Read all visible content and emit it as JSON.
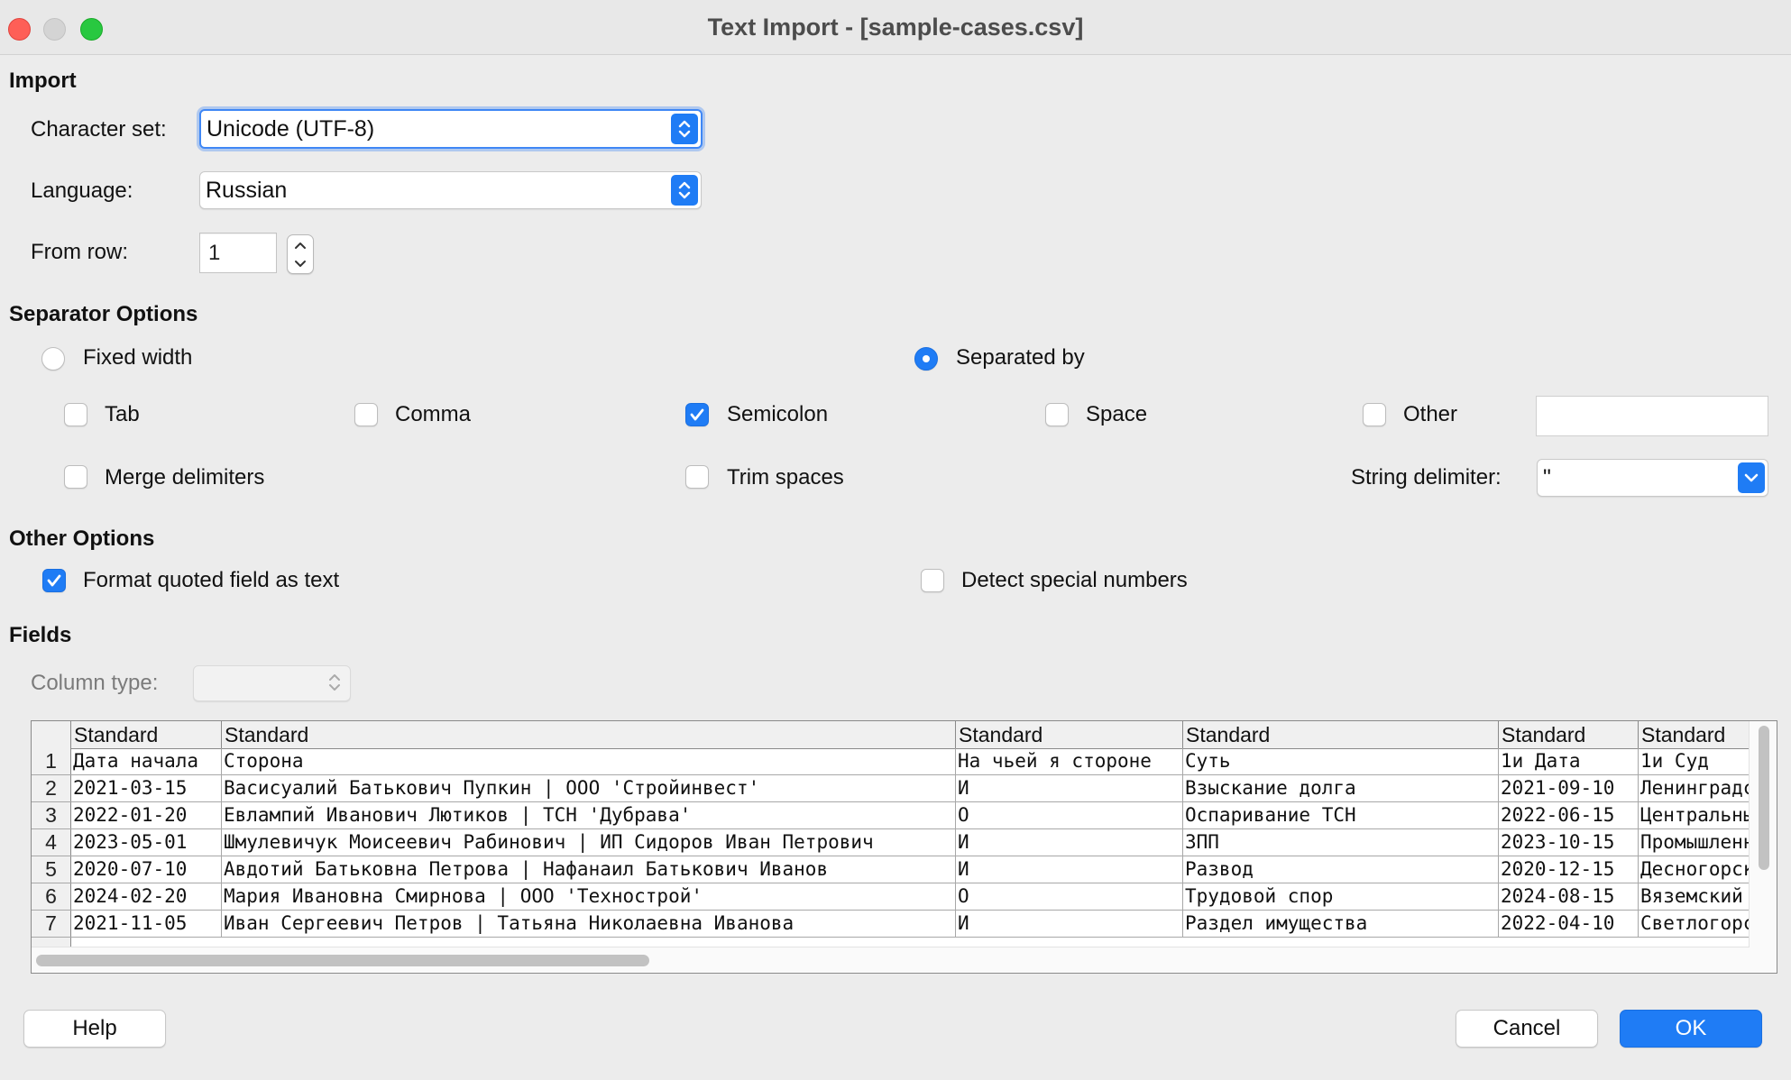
{
  "window": {
    "title": "Text Import - [sample-cases.csv]"
  },
  "import": {
    "heading": "Import",
    "charset_label": "Character set:",
    "charset_value": "Unicode (UTF-8)",
    "language_label": "Language:",
    "language_value": "Russian",
    "from_row_label": "From row:",
    "from_row_value": "1"
  },
  "separator": {
    "heading": "Separator Options",
    "fixed_width": {
      "label": "Fixed width",
      "selected": false
    },
    "separated_by": {
      "label": "Separated by",
      "selected": true
    },
    "tab": {
      "label": "Tab",
      "checked": false
    },
    "comma": {
      "label": "Comma",
      "checked": false
    },
    "semicolon": {
      "label": "Semicolon",
      "checked": true
    },
    "space": {
      "label": "Space",
      "checked": false
    },
    "other": {
      "label": "Other",
      "checked": false,
      "value": ""
    },
    "merge": {
      "label": "Merge delimiters",
      "checked": false
    },
    "trim": {
      "label": "Trim spaces",
      "checked": false
    },
    "string_delimiter_label": "String delimiter:",
    "string_delimiter_value": "\""
  },
  "other_options": {
    "heading": "Other Options",
    "format_quoted": {
      "label": "Format quoted field as text",
      "checked": true
    },
    "detect_special": {
      "label": "Detect special numbers",
      "checked": false
    }
  },
  "fields": {
    "heading": "Fields",
    "column_type_label": "Column type:",
    "column_type_value": "",
    "headers": [
      "Standard",
      "Standard",
      "Standard",
      "Standard",
      "Standard",
      "Standard"
    ],
    "rows": [
      {
        "num": "1",
        "cells": [
          "Дата начала",
          "Сторона",
          "На чьей я стороне",
          "Суть",
          "1и Дата",
          "1и Суд"
        ]
      },
      {
        "num": "2",
        "cells": [
          "2021-03-15",
          "Васисуалий Батькович Пупкин | ООО 'Стройинвест'",
          "И",
          "Взыскание долга",
          "2021-09-10",
          "Ленинградский"
        ]
      },
      {
        "num": "3",
        "cells": [
          "2022-01-20",
          "Евлампий Иванович Лютиков | ТСН 'Дубрава'",
          "О",
          "Оспаривание ТСН",
          "2022-06-15",
          "Центральный"
        ]
      },
      {
        "num": "4",
        "cells": [
          "2023-05-01",
          "Шмулевичук Моисеевич Рабинович | ИП Сидоров Иван Петрович",
          "И",
          "ЗПП",
          "2023-10-15",
          "Промышленный"
        ]
      },
      {
        "num": "5",
        "cells": [
          "2020-07-10",
          "Авдотий Батьковна Петрова | Нафанаил Батькович Иванов",
          "И",
          "Развод",
          "2020-12-15",
          "Десногорский"
        ]
      },
      {
        "num": "6",
        "cells": [
          "2024-02-20",
          "Мария Ивановна Смирнова | ООО 'Технострой'",
          "О",
          "Трудовой спор",
          "2024-08-15",
          "Вяземский"
        ]
      },
      {
        "num": "7",
        "cells": [
          "2021-11-05",
          "Иван Сергеевич Петров | Татьяна Николаевна Иванова",
          "И",
          "Раздел имущества",
          "2022-04-10",
          "Светлогорский"
        ]
      }
    ]
  },
  "buttons": {
    "help": "Help",
    "cancel": "Cancel",
    "ok": "OK"
  },
  "colors": {
    "accent": "#1f7cf5"
  }
}
